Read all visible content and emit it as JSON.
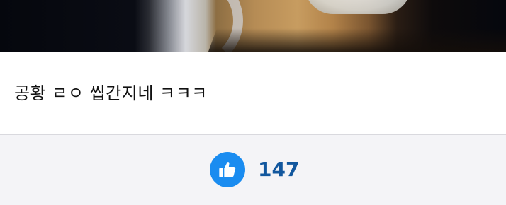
{
  "comment": {
    "text": "공황 ㄹㅇ 씹간지네 ㅋㅋㅋ"
  },
  "reactions": {
    "like_icon": "thumbs-up-icon",
    "like_count": "147",
    "accent_color": "#1a8cf0",
    "count_color": "#12579e"
  }
}
